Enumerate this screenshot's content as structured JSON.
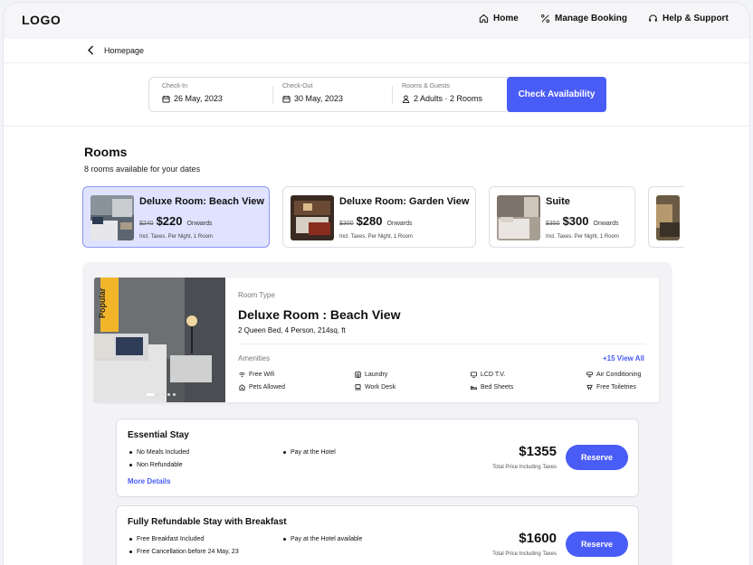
{
  "header": {
    "logo": "LOGO",
    "nav": [
      {
        "label": "Home",
        "icon": "home-icon"
      },
      {
        "label": "Manage Booking",
        "icon": "tag-percent-icon"
      },
      {
        "label": "Help & Support",
        "icon": "headset-icon"
      }
    ]
  },
  "breadcrumb": {
    "label": "Homepage"
  },
  "search": {
    "checkin_label": "Check-In",
    "checkin_value": "26 May, 2023",
    "checkout_label": "Check-Out",
    "checkout_value": "30 May, 2023",
    "guests_label": "Rooms & Guests",
    "guests_value": "2 Adults · 2 Rooms",
    "button": "Check Availability"
  },
  "rooms_section": {
    "title": "Rooms",
    "subtitle": "8 rooms available for your dates",
    "cards": [
      {
        "name": "Deluxe Room: Beach View",
        "old_price": "$240",
        "price": "$220",
        "onwards": "Onwards",
        "note": "Incl. Taxes. Per Night, 1 Room"
      },
      {
        "name": "Deluxe Room: Garden View",
        "old_price": "$300",
        "price": "$280",
        "onwards": "Onwards",
        "note": "Incl. Taxes. Per Night, 1 Room"
      },
      {
        "name": "Suite",
        "old_price": "$350",
        "price": "$300",
        "onwards": "Onwards",
        "note": "Incl. Taxes. Per Night, 1 Room"
      }
    ]
  },
  "room_detail": {
    "badge": "Popular",
    "type_label": "Room Type",
    "name": "Deluxe Room : Beach View",
    "spec": "2 Queen Bed, 4 Person, 214sq. ft",
    "amenities_label": "Amenities",
    "view_all": "+15 View All",
    "amenities": [
      {
        "label": "Free Wifi",
        "icon": "wifi-icon"
      },
      {
        "label": "Laundry",
        "icon": "laundry-icon"
      },
      {
        "label": "LCD T.V.",
        "icon": "tv-icon"
      },
      {
        "label": "Air Conditioning",
        "icon": "air-conditioning-icon"
      },
      {
        "label": "Pets Allowed",
        "icon": "pet-icon"
      },
      {
        "label": "Work Desk",
        "icon": "desk-icon"
      },
      {
        "label": "Bed Sheets",
        "icon": "bed-icon"
      },
      {
        "label": "Free Toiletries",
        "icon": "toiletries-icon"
      }
    ]
  },
  "plans": [
    {
      "title": "Essential Stay",
      "features": [
        "No Meals Included",
        "Non Refundable",
        "Pay at the Hotel"
      ],
      "more": "More Details",
      "total": "$1355",
      "total_note": "Total Price Including Taxes",
      "button": "Reserve"
    },
    {
      "title": "Fully Refundable Stay with Breakfast",
      "features": [
        "Free Breakfast Included",
        "Free Cancellation before 24 May, 23",
        "Pay at the Hotel available"
      ],
      "total": "$1600",
      "total_note": "Total Price Including Taxes",
      "button": "Reserve"
    }
  ],
  "colors": {
    "accent": "#4a5cf6",
    "selected_card": "#dfe3ff",
    "ribbon": "#f2b52a"
  }
}
